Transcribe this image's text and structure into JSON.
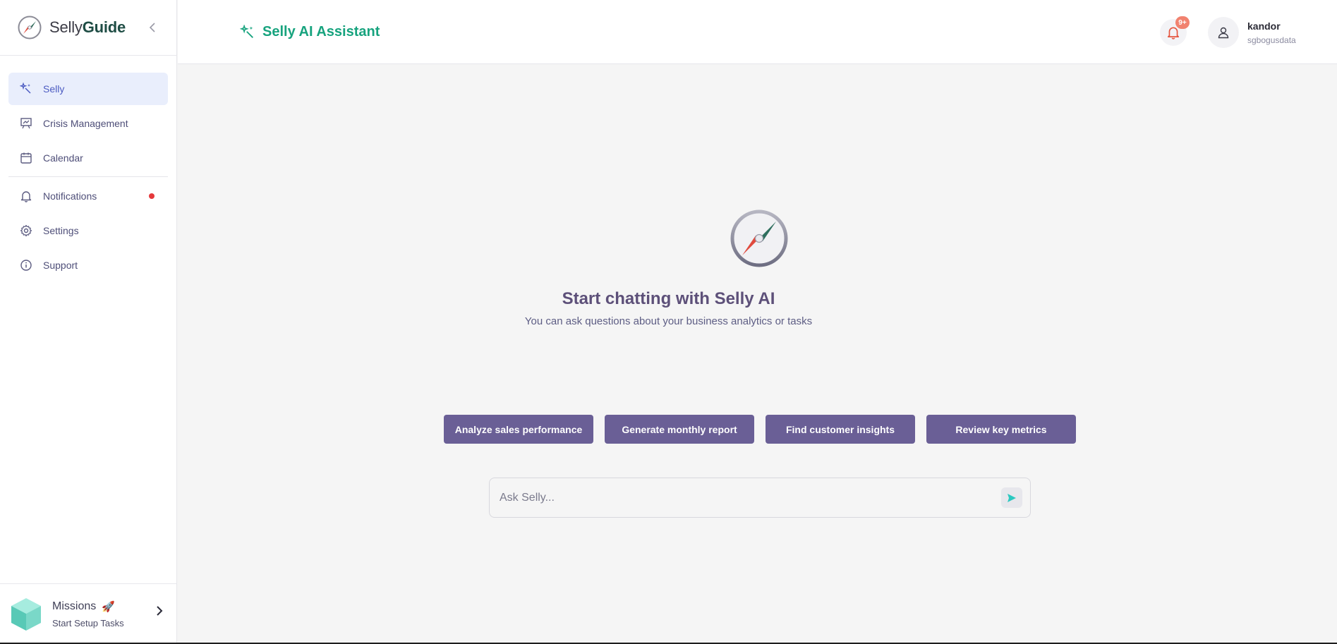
{
  "brand": {
    "name_light": "Selly",
    "name_bold": "Guide",
    "collapse_icon": "chevron-left-icon"
  },
  "sidebar": {
    "items": [
      {
        "label": "Selly",
        "icon": "sparkle-wand-icon",
        "active": true
      },
      {
        "label": "Crisis Management",
        "icon": "presentation-chart-icon"
      },
      {
        "label": "Calendar",
        "icon": "calendar-icon"
      },
      {
        "label": "Notifications",
        "icon": "bell-icon",
        "has_dot": true
      },
      {
        "label": "Settings",
        "icon": "gear-icon"
      },
      {
        "label": "Support",
        "icon": "info-icon"
      }
    ],
    "missions": {
      "title": "Missions",
      "rocket": "🚀",
      "subtitle": "Start Setup Tasks",
      "icon": "cube-icon"
    }
  },
  "header": {
    "title": "Selly AI Assistant",
    "notification_badge": "9+",
    "user": {
      "name": "kandor",
      "org": "sgbogusdata"
    }
  },
  "main": {
    "hero_title": "Start chatting with Selly AI",
    "hero_subtitle": "You can ask questions about your business analytics or tasks",
    "suggestions": [
      "Analyze sales performance",
      "Generate monthly report",
      "Find customer insights",
      "Review key metrics"
    ],
    "ask": {
      "placeholder": "Ask Selly...",
      "value": ""
    }
  },
  "colors": {
    "accent_green": "#17a37e",
    "button_purple": "#6a5f96",
    "active_bg": "#e9eefc",
    "badge": "#f1826f",
    "dot": "#e5383b"
  }
}
